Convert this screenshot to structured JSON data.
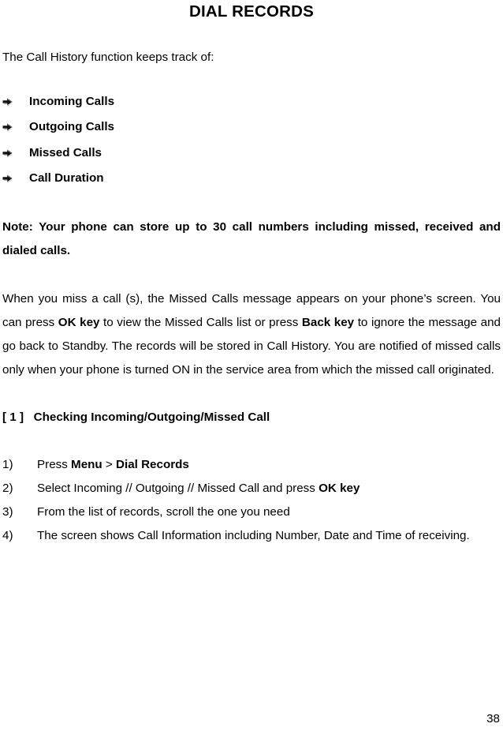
{
  "document": {
    "title": "DIAL RECORDS",
    "intro": "The Call History function keeps track of:",
    "bullets": [
      {
        "label": "Incoming Calls",
        "icon": "arrow-bullet-icon"
      },
      {
        "label": "Outgoing Calls",
        "icon": "arrow-bullet-icon"
      },
      {
        "label": "Missed Calls",
        "icon": "arrow-bullet-icon"
      },
      {
        "label": "Call Duration",
        "icon": "arrow-bullet-icon"
      }
    ],
    "note": "Note:   Your phone can store up to 30 call numbers including missed, received and dialed calls.",
    "body": {
      "part1": "When you miss a call (s), the Missed Calls message  appears on your phone’s screen. You can press ",
      "emphasis1": "OK key",
      "part2": " to view the Missed Calls list or press ",
      "emphasis2": "Back key",
      "part3": " to ignore the message and go back to Standby. The records will be stored in Call History. You are notified of missed calls only when your phone is turned ON in the service area from which the missed call originated."
    },
    "section_heading": "[ 1 ]   Checking Incoming/Outgoing/Missed Call",
    "steps": [
      {
        "number": "1)",
        "text_before": "Press ",
        "emphasis1": "Menu",
        "text_middle": " > ",
        "emphasis2": "Dial Records",
        "text_after": ""
      },
      {
        "number": "2)",
        "text_before": "Select Incoming // Outgoing // Missed Call and press ",
        "emphasis1": "OK key",
        "text_middle": "",
        "emphasis2": "",
        "text_after": ""
      },
      {
        "number": "3)",
        "text_before": "From the list of records, scroll the one you need",
        "emphasis1": "",
        "text_middle": "",
        "emphasis2": "",
        "text_after": ""
      },
      {
        "number": "4)",
        "text_before": "The screen shows Call Information including Number, Date and Time of receiving.",
        "emphasis1": "",
        "text_middle": "",
        "emphasis2": "",
        "text_after": ""
      }
    ],
    "page_number": "38"
  },
  "colors": {
    "text": "#000000",
    "background": "#ffffff"
  }
}
